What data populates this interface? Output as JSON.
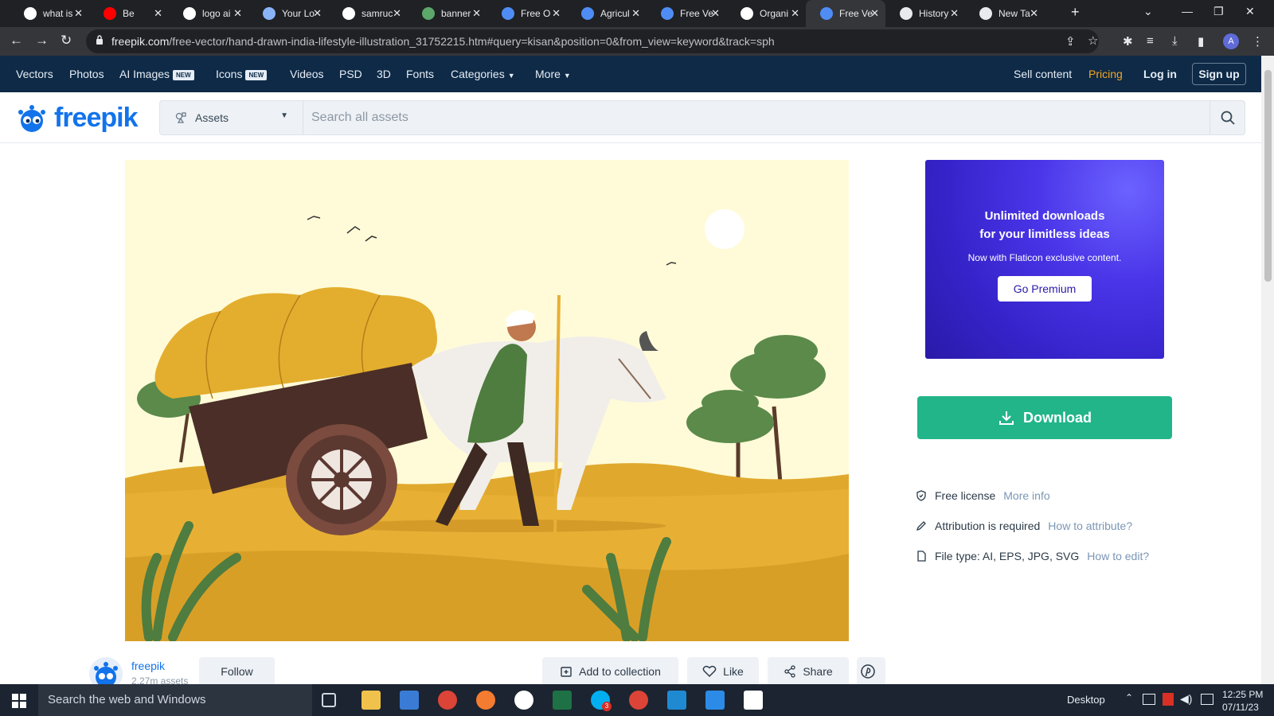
{
  "browser": {
    "tabs": [
      {
        "title": "what is",
        "favicon": "google-icon",
        "favicon_color": "#ffffff"
      },
      {
        "title": "Be",
        "favicon": "youtube-icon",
        "favicon_color": "#ff0000"
      },
      {
        "title": "logo ai",
        "favicon": "google-icon",
        "favicon_color": "#ffffff"
      },
      {
        "title": "Your Lo",
        "favicon": "link-icon",
        "favicon_color": "#8ab4f8"
      },
      {
        "title": "samruc",
        "favicon": "google-icon",
        "favicon_color": "#ffffff"
      },
      {
        "title": "banner",
        "favicon": "tree-icon",
        "favicon_color": "#5ca86a"
      },
      {
        "title": "Free O",
        "favicon": "c-icon",
        "favicon_color": "#4f8df5"
      },
      {
        "title": "Agricul",
        "favicon": "freepik-icon",
        "favicon_color": "#4f8df5"
      },
      {
        "title": "Free Ve",
        "favicon": "freepik-icon",
        "favicon_color": "#4f8df5"
      },
      {
        "title": "Organi",
        "favicon": "st-icon",
        "favicon_color": "#ffffff"
      },
      {
        "title": "Free Ve",
        "favicon": "freepik-icon",
        "favicon_color": "#4f8df5",
        "active": true
      },
      {
        "title": "History",
        "favicon": "history-icon",
        "favicon_color": "#e8eaed"
      },
      {
        "title": "New Ta",
        "favicon": "chrome-icon",
        "favicon_color": "#e8eaed"
      }
    ],
    "url_domain": "freepik.com",
    "url_path": "/free-vector/hand-drawn-india-lifestyle-illustration_31752215.htm#query=kisan&position=0&from_view=keyword&track=sph",
    "profile_initial": "A"
  },
  "nav": {
    "items": [
      {
        "label": "Vectors"
      },
      {
        "label": "Photos"
      },
      {
        "label": "AI Images",
        "badge": "NEW"
      },
      {
        "label": "Icons",
        "badge": "NEW"
      },
      {
        "label": "Videos"
      },
      {
        "label": "PSD"
      },
      {
        "label": "3D"
      },
      {
        "label": "Fonts"
      },
      {
        "label": "Categories",
        "dropdown": true
      },
      {
        "label": "More",
        "dropdown": true
      }
    ],
    "sell": "Sell content",
    "pricing": "Pricing",
    "login": "Log in",
    "signup": "Sign up"
  },
  "search": {
    "logo_text": "freepik",
    "asset_type": "Assets",
    "placeholder": "Search all assets"
  },
  "promo": {
    "line1": "Unlimited downloads",
    "line2": "for your limitless ideas",
    "line3": "Now with Flaticon exclusive content.",
    "button": "Go Premium"
  },
  "download": {
    "label": "Download"
  },
  "license": {
    "free_label": "Free license",
    "free_link": "More info",
    "attribution_label": "Attribution is required",
    "attribution_link": "How to attribute?",
    "filetype_label": "File type: AI, EPS, JPG, SVG",
    "filetype_link": "How to edit?"
  },
  "author": {
    "name": "freepik",
    "asset_count": "2.27m assets",
    "follow": "Follow"
  },
  "actions": {
    "collection": "Add to collection",
    "like": "Like",
    "share": "Share"
  },
  "taskbar": {
    "search_placeholder": "Search the web and Windows",
    "desktop": "Desktop",
    "time": "12:25 PM",
    "date": "07/11/23",
    "skype_badge": "3"
  },
  "colors": {
    "brand_blue": "#1273eb",
    "nav_bg": "#0e2a47",
    "download_green": "#21b589",
    "pricing_orange": "#f5a623"
  }
}
